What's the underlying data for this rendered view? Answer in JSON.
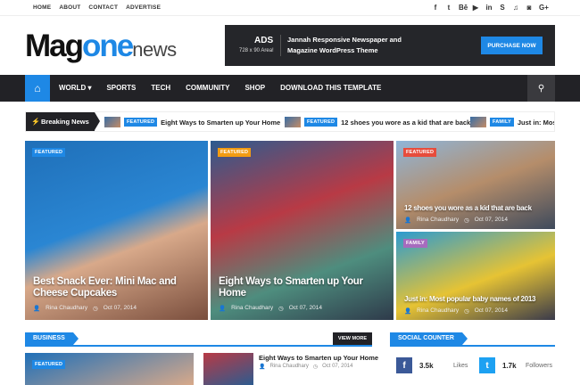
{
  "top_links": [
    "HOME",
    "ABOUT",
    "CONTACT",
    "ADVERTISE"
  ],
  "top_social": [
    "f",
    "t",
    "Bē",
    "▶",
    "in",
    "S",
    "♫",
    "◙",
    "G+"
  ],
  "logo": {
    "main": "Mag",
    "accent": "one",
    "suffix": "news"
  },
  "ad": {
    "title": "ADS",
    "size": "728 x 90 Area!",
    "text": "Jannah Responsive Newspaper and Magazine WordPress Theme",
    "button": "PURCHASE NOW"
  },
  "nav": {
    "home_icon": "⌂",
    "items": [
      "WORLD ▾",
      "SPORTS",
      "TECH",
      "COMMUNITY",
      "SHOP",
      "DOWNLOAD THIS TEMPLATE"
    ],
    "search_icon": "⚲"
  },
  "breaking": {
    "label": "Breaking News",
    "items": [
      {
        "tag": "FEATURED",
        "title": "Eight Ways to Smarten up Your Home"
      },
      {
        "tag": "FEATURED",
        "title": "12 shoes you wore as a kid that are back"
      },
      {
        "tag": "FAMILY",
        "title": "Just in: Mos"
      }
    ]
  },
  "cards": [
    {
      "tag": "FEATURED",
      "title": "Best Snack Ever: Mini Mac and Cheese Cupcakes",
      "author": "Rina Chaudhary",
      "date": "Oct 07, 2014"
    },
    {
      "tag": "FEATURED",
      "title": "Eight Ways to Smarten up Your Home",
      "author": "Rina Chaudhary",
      "date": "Oct 07, 2014"
    },
    {
      "tag": "FEATURED",
      "title": "12 shoes you wore as a kid that are back",
      "author": "Rina Chaudhary",
      "date": "Oct 07, 2014"
    },
    {
      "tag": "FAMILY",
      "title": "Just in: Most popular baby names of 2013",
      "author": "Rina Chaudhary",
      "date": "Oct 07, 2014"
    }
  ],
  "business": {
    "label": "BUSINESS",
    "view_more": "VIEW MORE",
    "thumb_tag": "FEATURED",
    "post_title": "Eight Ways to Smarten up Your Home",
    "post_author": "Rina Chaudhary",
    "post_date": "Oct 07, 2014"
  },
  "social_counter": {
    "label": "SOCIAL COUNTER",
    "facebook": {
      "icon": "f",
      "count": "3.5k",
      "label": "Likes",
      "color": "#3b5998"
    },
    "twitter": {
      "icon": "t",
      "count": "1.7k",
      "label": "Followers",
      "color": "#1da1f2"
    }
  },
  "colors": {
    "accent": "#1e88e5",
    "dark": "#222226"
  }
}
